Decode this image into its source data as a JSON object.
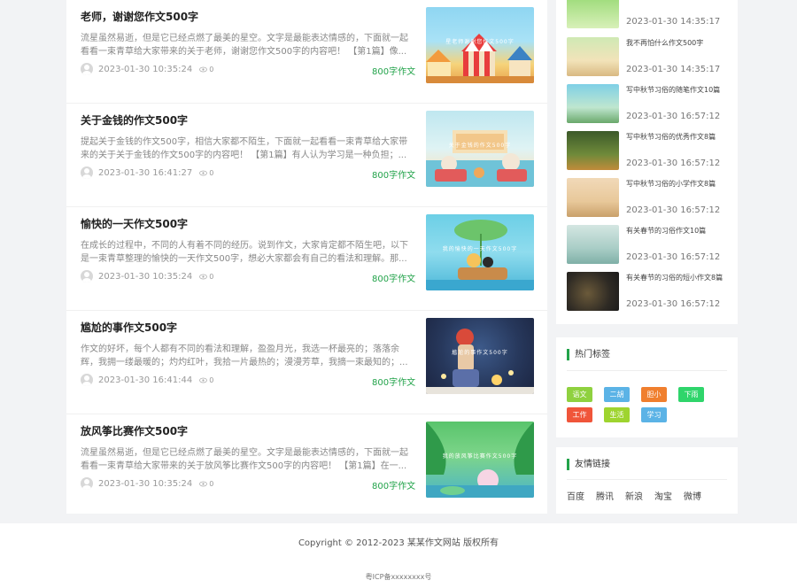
{
  "articles": [
    {
      "title": "老师，谢谢您作文500字",
      "excerpt": "流星虽然易逝，但是它已经点燃了最美的星空。文字是最能表达情感的，下面就一起看看一束青草给大家带来的关于老师，谢谢您作文500字的内容吧！ 【第1篇】像...",
      "date": "2023-01-30 10:35:24",
      "views": "0",
      "category": "800字作文",
      "thumb_caption": "星老师谢谢您作文500字"
    },
    {
      "title": "关于金钱的作文500字",
      "excerpt": "提起关于金钱的作文500字，相信大家都不陌生，下面就一起看看一束青草给大家带来的关于关于金钱的作文500字的内容吧！ 【第1篇】有人认为学习是一种负担；...",
      "date": "2023-01-30 16:41:27",
      "views": "0",
      "category": "800字作文",
      "thumb_caption": "关于金钱的作文500字"
    },
    {
      "title": "愉快的一天作文500字",
      "excerpt": "在成长的过程中，不同的人有着不同的经历。说到作文，大家肯定都不陌生吧，以下是一束青草整理的愉快的一天作文500字，想必大家都会有自己的看法和理解。那...",
      "date": "2023-01-30 10:35:24",
      "views": "0",
      "category": "800字作文",
      "thumb_caption": "我的愉快的一天作文500字"
    },
    {
      "title": "尴尬的事作文500字",
      "excerpt": "作文的好坏，每个人都有不同的看法和理解，盈盈月光，我选一杯最亮的；落落余辉，我拥一缕最暖的；灼灼红叶，我拾一片最热的；漫漫芳草，我摘一束最知的；...",
      "date": "2023-01-30 16:41:44",
      "views": "0",
      "category": "800字作文",
      "thumb_caption": "尴尬的事作文500字"
    },
    {
      "title": "放风筝比赛作文500字",
      "excerpt": "流星虽然易逝，但是它已经点燃了最美的星空。文字是最能表达情感的，下面就一起看看一束青草给大家带来的关于放风筝比赛作文500字的内容吧！ 【第1篇】在一...",
      "date": "2023-01-30 10:35:24",
      "views": "0",
      "category": "800字作文",
      "thumb_caption": "我的放风筝比赛作文500字"
    }
  ],
  "sidebar_articles": [
    {
      "title": "",
      "date": "2023-01-30 14:35:17"
    },
    {
      "title": "我不再怕什么作文500字",
      "date": "2023-01-30 14:35:17"
    },
    {
      "title": "写中秋节习俗的随笔作文10篇",
      "date": "2023-01-30 16:57:12"
    },
    {
      "title": "写中秋节习俗的优秀作文8篇",
      "date": "2023-01-30 16:57:12"
    },
    {
      "title": "写中秋节习俗的小学作文8篇",
      "date": "2023-01-30 16:57:12"
    },
    {
      "title": "有关春节的习俗作文10篇",
      "date": "2023-01-30 16:57:12"
    },
    {
      "title": "有关春节的习俗的短小作文8篇",
      "date": "2023-01-30 16:57:12"
    }
  ],
  "hot_tags": {
    "title": "热门标签",
    "tags": [
      {
        "label": "语文",
        "color": "#8fd13f"
      },
      {
        "label": "二胡",
        "color": "#5bb3e6"
      },
      {
        "label": "胆小",
        "color": "#f07f2e"
      },
      {
        "label": "下雨",
        "color": "#2fd56b"
      },
      {
        "label": "工作",
        "color": "#f0553a"
      },
      {
        "label": "生活",
        "color": "#9ed42f"
      },
      {
        "label": "学习",
        "color": "#5bb3e6"
      }
    ]
  },
  "friend_links": {
    "title": "友情链接",
    "links": [
      "百度",
      "腾讯",
      "新浪",
      "淘宝",
      "微博"
    ]
  },
  "footer": {
    "copyright": "Copyright © 2012-2023 某某作文网站 版权所有",
    "icp": "粤ICP备xxxxxxxx号"
  },
  "colors": {
    "accent": "#22a34a"
  }
}
